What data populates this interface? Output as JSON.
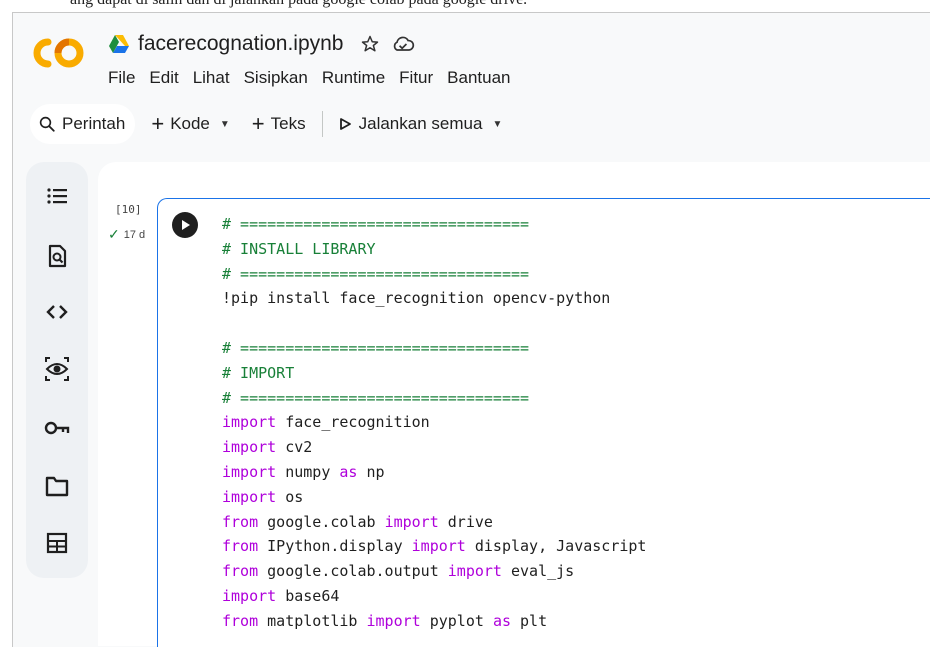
{
  "top_caption": "ang dapat di salin dan di jalankan pada google colab pada google drive.",
  "file": {
    "title": "facerecognation.ipynb"
  },
  "menu": {
    "items": [
      "File",
      "Edit",
      "Lihat",
      "Sisipkan",
      "Runtime",
      "Fitur",
      "Bantuan"
    ]
  },
  "toolbar": {
    "search_label": "Perintah",
    "add_code_label": "Kode",
    "add_text_label": "Teks",
    "run_all_label": "Jalankan semua"
  },
  "sidebar": {
    "icons": [
      "table-of-contents-icon",
      "find-replace-icon",
      "code-snippets-icon",
      "variables-icon",
      "secrets-key-icon",
      "files-folder-icon",
      "data-table-icon"
    ]
  },
  "cell": {
    "execution_count": "[10]",
    "status": "17 d",
    "code_lines": [
      [
        {
          "t": "c",
          "v": "# ================================"
        }
      ],
      [
        {
          "t": "c",
          "v": "# INSTALL LIBRARY"
        }
      ],
      [
        {
          "t": "c",
          "v": "# ================================"
        }
      ],
      [
        {
          "t": "n",
          "v": "!pip install face_recognition opencv-python"
        }
      ],
      [
        {
          "t": "n",
          "v": ""
        }
      ],
      [
        {
          "t": "c",
          "v": "# ================================"
        }
      ],
      [
        {
          "t": "c",
          "v": "# IMPORT"
        }
      ],
      [
        {
          "t": "c",
          "v": "# ================================"
        }
      ],
      [
        {
          "t": "k",
          "v": "import"
        },
        {
          "t": "n",
          "v": " face_recognition"
        }
      ],
      [
        {
          "t": "k",
          "v": "import"
        },
        {
          "t": "n",
          "v": " cv2"
        }
      ],
      [
        {
          "t": "k",
          "v": "import"
        },
        {
          "t": "n",
          "v": " numpy "
        },
        {
          "t": "k",
          "v": "as"
        },
        {
          "t": "n",
          "v": " np"
        }
      ],
      [
        {
          "t": "k",
          "v": "import"
        },
        {
          "t": "n",
          "v": " os"
        }
      ],
      [
        {
          "t": "k",
          "v": "from"
        },
        {
          "t": "n",
          "v": " google.colab "
        },
        {
          "t": "k",
          "v": "import"
        },
        {
          "t": "n",
          "v": " drive"
        }
      ],
      [
        {
          "t": "k",
          "v": "from"
        },
        {
          "t": "n",
          "v": " IPython.display "
        },
        {
          "t": "k",
          "v": "import"
        },
        {
          "t": "n",
          "v": " display, Javascript"
        }
      ],
      [
        {
          "t": "k",
          "v": "from"
        },
        {
          "t": "n",
          "v": " google.colab.output "
        },
        {
          "t": "k",
          "v": "import"
        },
        {
          "t": "n",
          "v": " eval_js"
        }
      ],
      [
        {
          "t": "k",
          "v": "import"
        },
        {
          "t": "n",
          "v": " base64"
        }
      ],
      [
        {
          "t": "k",
          "v": "from"
        },
        {
          "t": "n",
          "v": " matplotlib "
        },
        {
          "t": "k",
          "v": "import"
        },
        {
          "t": "n",
          "v": " pyplot "
        },
        {
          "t": "k",
          "v": "as"
        },
        {
          "t": "n",
          "v": " plt"
        }
      ]
    ]
  },
  "colors": {
    "accent": "#1a73e8",
    "comment": "#188038",
    "keyword": "#af00db",
    "logo_orange": "#f9ab00",
    "logo_dark_orange": "#e37400"
  }
}
